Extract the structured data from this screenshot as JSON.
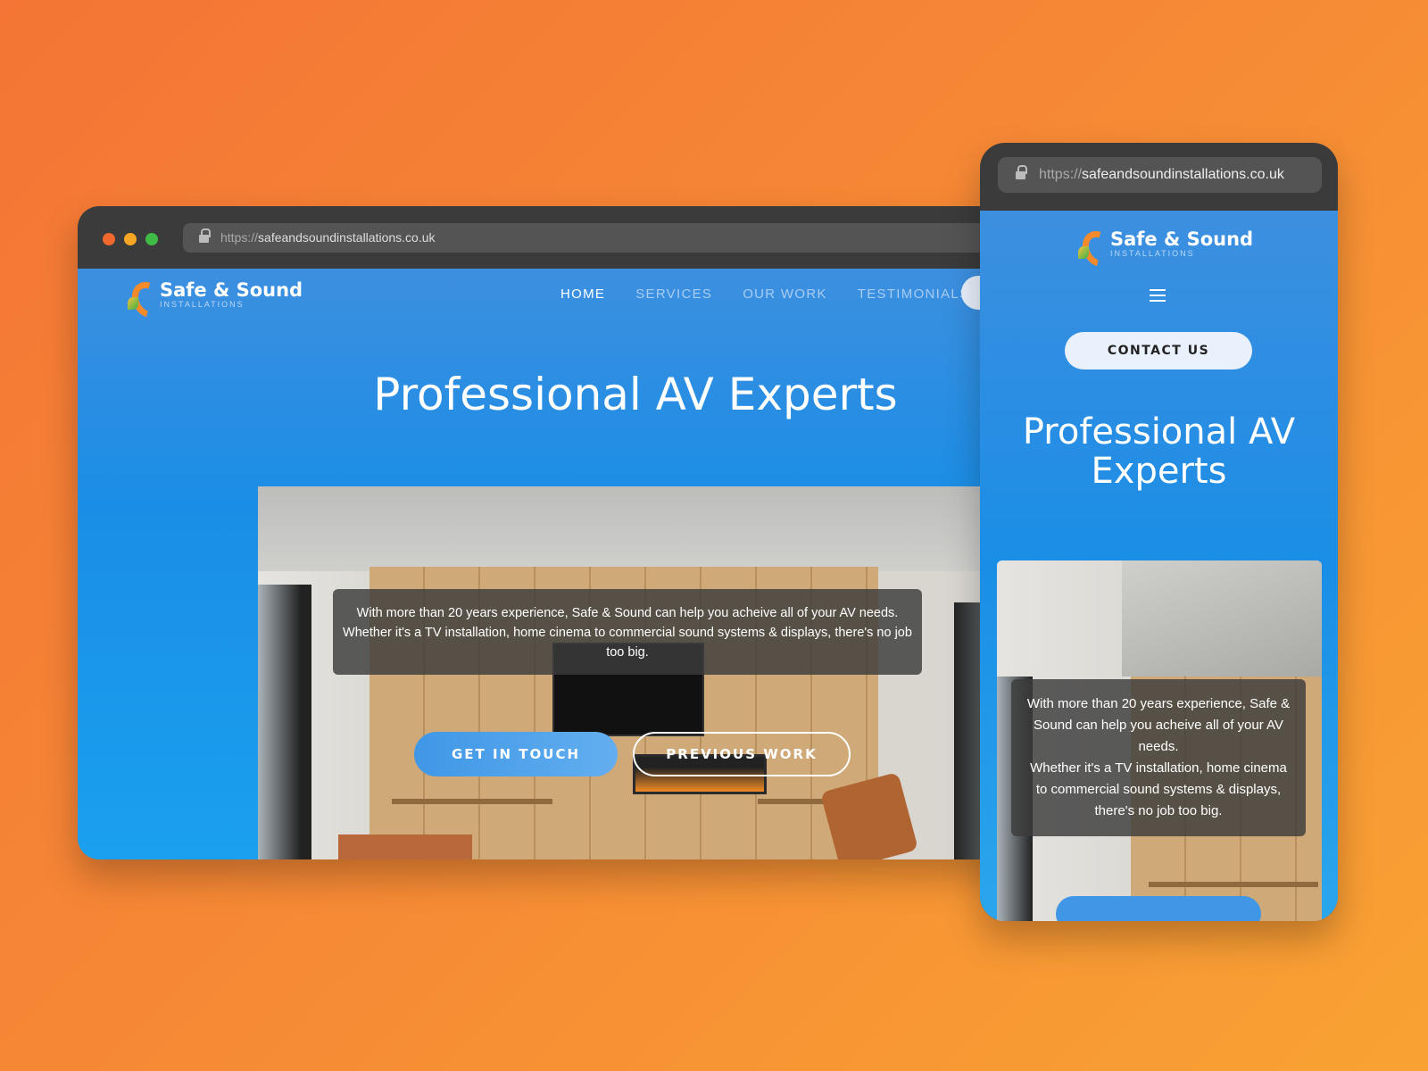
{
  "colors": {
    "background": "#f68a35",
    "brand_blue": "#1a8ee6",
    "browser_chrome": "#3b3b3b",
    "cta_blue": "#4aa0ec"
  },
  "desktop": {
    "window_controls": [
      "close",
      "minimize",
      "maximize"
    ],
    "url": {
      "protocol": "https://",
      "domain": "safeandsoundinstallations.co.uk"
    },
    "logo": {
      "name": "Safe & Sound",
      "tagline": "INSTALLATIONS"
    },
    "nav": [
      {
        "label": "HOME",
        "active": true
      },
      {
        "label": "SERVICES"
      },
      {
        "label": "OUR WORK"
      },
      {
        "label": "TESTIMONIALS"
      }
    ],
    "hero_title": "Professional AV Experts",
    "intro_line1": "With more than 20 years experience, Safe & Sound can help you acheive all of your AV needs.",
    "intro_line2": "Whether it's a  TV installation, home cinema to commercial sound systems & displays, there's no job too big.",
    "cta_primary": "GET IN TOUCH",
    "cta_secondary": "PREVIOUS WORK"
  },
  "mobile": {
    "url": {
      "protocol": "https://",
      "domain": "safeandsoundinstallations.co.uk"
    },
    "logo": {
      "name": "Safe & Sound",
      "tagline": "INSTALLATIONS"
    },
    "menu_icon": "hamburger-icon",
    "contact_label": "CONTACT US",
    "hero_title": "Professional AV Experts",
    "intro_line1": "With more than 20 years experience, Safe & Sound can help you acheive all of your AV needs.",
    "intro_line2": "Whether it's a  TV installation, home cinema to commercial sound systems & displays, there's no job too big."
  }
}
